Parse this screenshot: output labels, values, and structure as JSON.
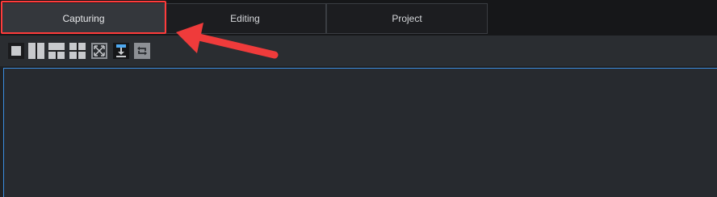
{
  "tabs": [
    {
      "label": "Capturing",
      "active": true
    },
    {
      "label": "Editing",
      "active": false
    },
    {
      "label": "Project",
      "active": false
    }
  ],
  "toolbar": {
    "tools": [
      {
        "icon": "single-view-icon"
      },
      {
        "icon": "split-vertical-icon"
      },
      {
        "icon": "split-horizontal-icon"
      },
      {
        "icon": "quad-grid-icon"
      },
      {
        "icon": "fullscreen-icon"
      },
      {
        "icon": "download-icon"
      },
      {
        "icon": "cycle-icon"
      }
    ]
  },
  "colors": {
    "accent_highlight": "#ff3b3b",
    "viewport_border": "#3a8ddf",
    "background": "#272a2f"
  }
}
